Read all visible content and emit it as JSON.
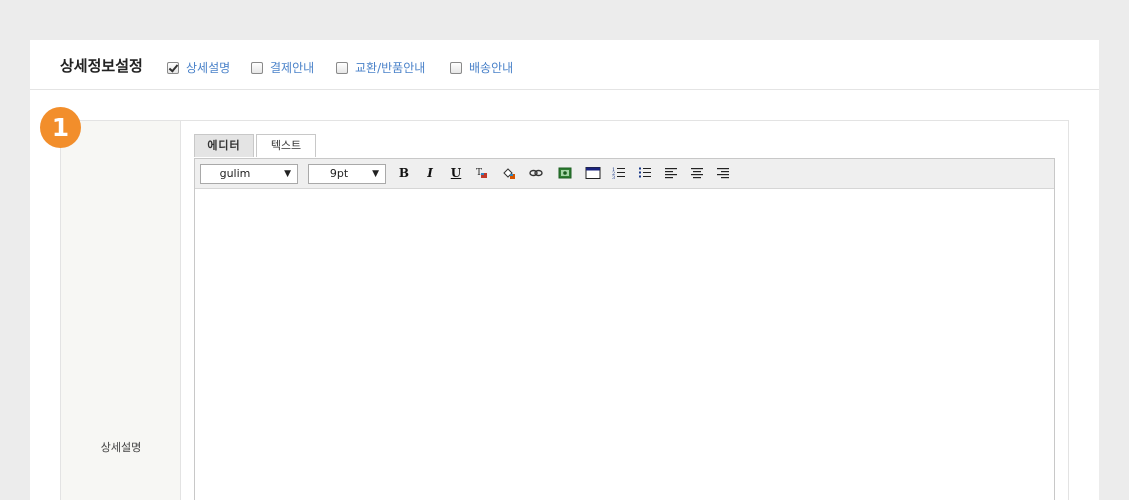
{
  "header": {
    "title": "상세정보설정",
    "options": [
      {
        "label": "상세설명",
        "checked": true
      },
      {
        "label": "결제안내",
        "checked": false
      },
      {
        "label": "교환/반품안내",
        "checked": false
      },
      {
        "label": "배송안내",
        "checked": false
      }
    ]
  },
  "step_badge": "1",
  "field_label": "상세설명",
  "tabs": [
    {
      "label": "에디터",
      "active": true
    },
    {
      "label": "텍스트",
      "active": false
    }
  ],
  "toolbar": {
    "font_value": "gulim",
    "size_value": "9pt",
    "bold": "B",
    "italic": "I",
    "underline": "U",
    "icons": [
      "font-color-icon",
      "background-color-icon",
      "link-icon",
      "image-icon",
      "table-icon",
      "ordered-list-icon",
      "unordered-list-icon",
      "align-left-icon",
      "align-center-icon",
      "align-right-icon"
    ]
  },
  "colors": {
    "accent_link": "#4a82c9",
    "badge": "#f28e2b",
    "page_bg": "#ececec"
  }
}
